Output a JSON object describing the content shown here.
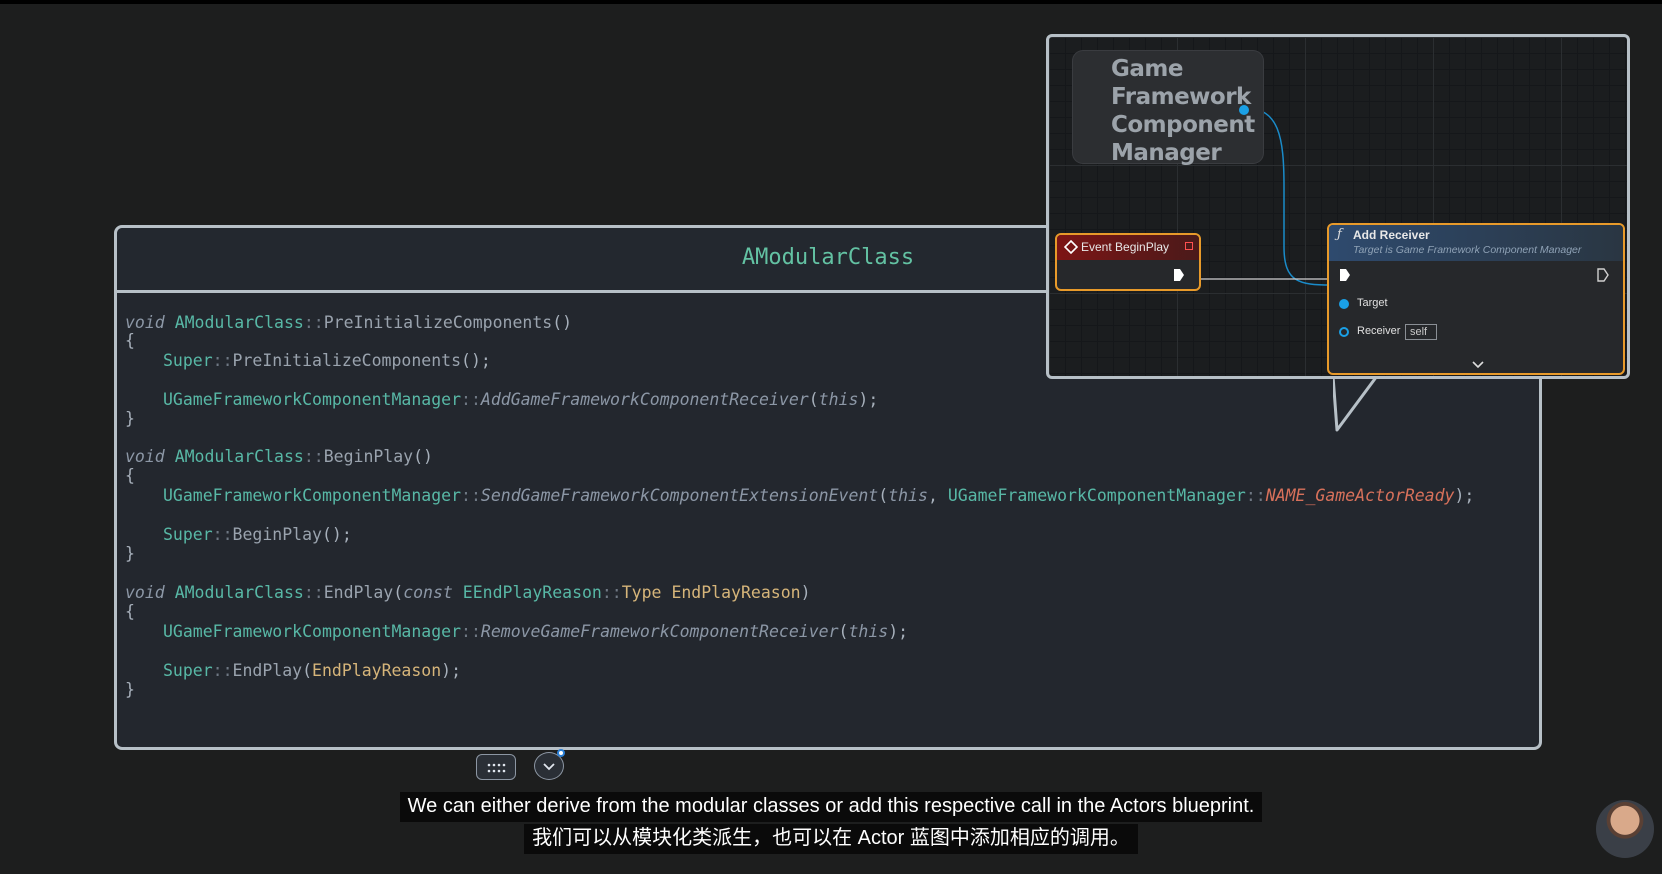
{
  "code_panel": {
    "class_name": "AModularClass",
    "lines": [
      {
        "segments": [
          {
            "t": "void",
            "c": "kw"
          },
          {
            "t": " "
          },
          {
            "t": "AModularClass",
            "c": "cls"
          },
          {
            "t": "::",
            "c": "sep"
          },
          {
            "t": "PreInitializeComponents",
            "c": "fn"
          },
          {
            "t": "()",
            "c": "punc"
          }
        ]
      },
      {
        "segments": [
          {
            "t": "{",
            "c": "punc"
          }
        ]
      },
      {
        "indent": true,
        "segments": [
          {
            "t": "Super",
            "c": "cls"
          },
          {
            "t": "::",
            "c": "sep"
          },
          {
            "t": "PreInitializeComponents",
            "c": "fn"
          },
          {
            "t": "();",
            "c": "punc"
          }
        ]
      },
      {
        "indent": true,
        "segments": [
          {
            "t": "UGameFrameworkComponentManager",
            "c": "cls"
          },
          {
            "t": "::",
            "c": "sep"
          },
          {
            "t": "AddGameFrameworkComponentReceiver",
            "c": "call"
          },
          {
            "t": "(",
            "c": "punc"
          },
          {
            "t": "this",
            "c": "kw"
          },
          {
            "t": ");",
            "c": "punc"
          }
        ]
      },
      {
        "segments": [
          {
            "t": "}",
            "c": "punc"
          }
        ]
      },
      {
        "segments": [
          {
            "t": "void",
            "c": "kw"
          },
          {
            "t": " "
          },
          {
            "t": "AModularClass",
            "c": "cls"
          },
          {
            "t": "::",
            "c": "sep"
          },
          {
            "t": "BeginPlay",
            "c": "fn"
          },
          {
            "t": "()",
            "c": "punc"
          }
        ]
      },
      {
        "segments": [
          {
            "t": "{",
            "c": "punc"
          }
        ]
      },
      {
        "indent": true,
        "segments": [
          {
            "t": "UGameFrameworkComponentManager",
            "c": "cls"
          },
          {
            "t": "::",
            "c": "sep"
          },
          {
            "t": "SendGameFrameworkComponentExtensionEvent",
            "c": "call"
          },
          {
            "t": "(",
            "c": "punc"
          },
          {
            "t": "this",
            "c": "kw"
          },
          {
            "t": ", ",
            "c": "punc"
          },
          {
            "t": "UGameFrameworkComponentManager",
            "c": "cls"
          },
          {
            "t": "::",
            "c": "sep"
          },
          {
            "t": "NAME_GameActorReady",
            "c": "orn"
          },
          {
            "t": ");",
            "c": "punc"
          }
        ]
      },
      {
        "indent": true,
        "segments": [
          {
            "t": "Super",
            "c": "cls"
          },
          {
            "t": "::",
            "c": "sep"
          },
          {
            "t": "BeginPlay",
            "c": "fn"
          },
          {
            "t": "();",
            "c": "punc"
          }
        ]
      },
      {
        "segments": [
          {
            "t": "}",
            "c": "punc"
          }
        ]
      },
      {
        "segments": [
          {
            "t": "void",
            "c": "kw"
          },
          {
            "t": " "
          },
          {
            "t": "AModularClass",
            "c": "cls"
          },
          {
            "t": "::",
            "c": "sep"
          },
          {
            "t": "EndPlay",
            "c": "fn"
          },
          {
            "t": "(",
            "c": "punc"
          },
          {
            "t": "const",
            "c": "kw"
          },
          {
            "t": " "
          },
          {
            "t": "EEndPlayReason",
            "c": "cls"
          },
          {
            "t": "::",
            "c": "sep"
          },
          {
            "t": "Type",
            "c": "yel"
          },
          {
            "t": " "
          },
          {
            "t": "EndPlayReason",
            "c": "yel"
          },
          {
            "t": ")",
            "c": "punc"
          }
        ]
      },
      {
        "segments": [
          {
            "t": "{",
            "c": "punc"
          }
        ]
      },
      {
        "indent": true,
        "segments": [
          {
            "t": "UGameFrameworkComponentManager",
            "c": "cls"
          },
          {
            "t": "::",
            "c": "sep"
          },
          {
            "t": "RemoveGameFrameworkComponentReceiver",
            "c": "call"
          },
          {
            "t": "(",
            "c": "punc"
          },
          {
            "t": "this",
            "c": "kw"
          },
          {
            "t": ");",
            "c": "punc"
          }
        ]
      },
      {
        "indent": true,
        "segments": [
          {
            "t": "Super",
            "c": "cls"
          },
          {
            "t": "::",
            "c": "sep"
          },
          {
            "t": "EndPlay",
            "c": "fn"
          },
          {
            "t": "(",
            "c": "punc"
          },
          {
            "t": "EndPlayReason",
            "c": "yel"
          },
          {
            "t": ");",
            "c": "punc"
          }
        ]
      },
      {
        "segments": [
          {
            "t": "}",
            "c": "punc"
          }
        ]
      }
    ],
    "colors": {
      "class": "#58b8a6",
      "keyword": "#8c97a6",
      "param": "#d6b57a",
      "name_constant": "#d8715b"
    }
  },
  "blueprint": {
    "manager_node": {
      "title": "Game Framework Component Manager",
      "lines": [
        "Game",
        "Framework",
        "Component",
        "Manager"
      ]
    },
    "event_node": {
      "title": "Event BeginPlay",
      "icon": "event-diamond-icon"
    },
    "add_receiver_node": {
      "title": "Add Receiver",
      "subtitle": "Target is Game Framework Component Manager",
      "pins": [
        "Target",
        "Receiver"
      ],
      "receiver_default": "self",
      "icon": "function-icon"
    },
    "colors": {
      "border": "#e89a2a",
      "event_header": "#7d1515",
      "function_header": "#2e4a6e",
      "object_pin": "#1aa0e6"
    }
  },
  "player": {
    "captions_en": "We can either derive from the modular classes or add this respective call in the Actors blueprint.",
    "captions_zh": "我们可以从模块化类派生，也可以在 Actor 蓝图中添加相应的调用。",
    "controls": [
      "grid-icon",
      "chevron-down-icon"
    ]
  }
}
